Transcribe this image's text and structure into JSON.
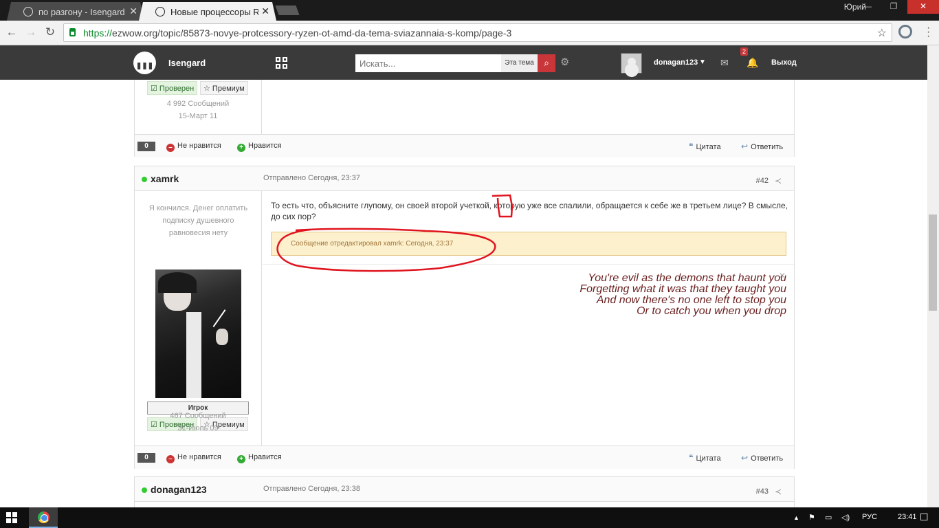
{
  "browser": {
    "tabs": [
      {
        "title": "по разгону - Isengard",
        "active": false
      },
      {
        "title": "Новые процессоры RyZ",
        "active": true
      }
    ],
    "tab_close": "✕",
    "profile_name": "Юрий",
    "window_controls": {
      "minimize": "—",
      "maximize": "❐",
      "close": "✕"
    },
    "url_scheme": "https://",
    "url_rest": "ezwow.org/topic/85873-novye-protcessory-ryzen-ot-amd-da-tema-sviazannaia-s-komp/page-3"
  },
  "site": {
    "name": "Isengard",
    "search_placeholder": "Искать...",
    "search_scope": "Эта тема",
    "username": "donagan123",
    "notification_count": "2",
    "logout_label": "Выход"
  },
  "labels": {
    "verified": "Проверен",
    "premium": "Премиум",
    "dislike": "Не нравится",
    "like": "Нравится",
    "quote": "Цитата",
    "reply": "Ответить"
  },
  "prev_post": {
    "post_count": "4 992 Сообщений",
    "joined": "15-Март 11",
    "reputation": "0"
  },
  "post_42": {
    "author": "xamrk",
    "posted": "Отправлено Сегодня, 23:37",
    "number": "#42",
    "user_title": "Я кончился. Денег оплатить подписку душевного равновесия нету",
    "group": "Игрок",
    "post_count": "467 Сообщений",
    "joined": "31-Июль 09",
    "text": "То есть что, объясните глупому, он своей второй учеткой, которую уже все спалили, обращается к себе же в третьем лице? В смысле, до сих пор?",
    "edit_note": "Сообщение отредактировал xamrk: Сегодня, 23:37",
    "signature": [
      "You're evil as the demons that haunt you",
      "Forgetting what it was that they taught you",
      "And now there's no one left to stop you",
      "Or to catch you when you drop"
    ],
    "reputation": "0"
  },
  "post_43": {
    "author": "donagan123",
    "posted": "Отправлено Сегодня, 23:38",
    "number": "#43"
  },
  "taskbar": {
    "language": "РУС",
    "time": "23:41"
  },
  "annotation_color": "#e0141e"
}
